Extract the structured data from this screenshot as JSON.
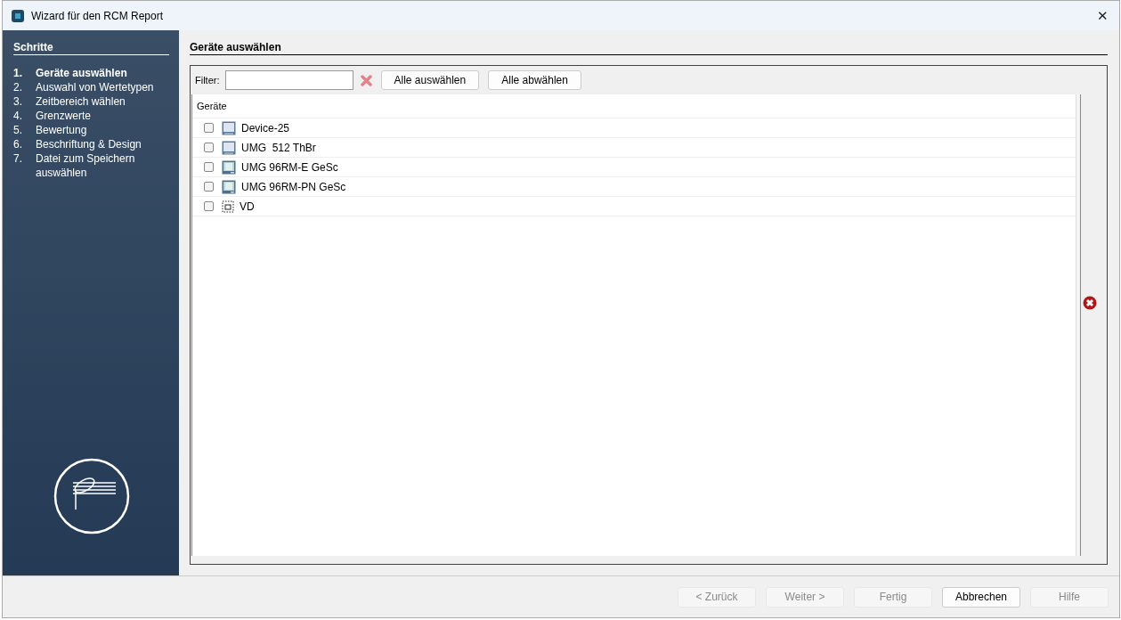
{
  "window": {
    "title": "Wizard für den RCM Report",
    "close": "✕"
  },
  "sidebar": {
    "heading": "Schritte",
    "steps": [
      {
        "number": "1.",
        "label": "Geräte auswählen",
        "selected": true
      },
      {
        "number": "2.",
        "label": "Auswahl von Wertetypen",
        "selected": false
      },
      {
        "number": "3.",
        "label": "Zeitbereich wählen",
        "selected": false
      },
      {
        "number": "4.",
        "label": "Grenzwerte",
        "selected": false
      },
      {
        "number": "5.",
        "label": "Bewertung",
        "selected": false
      },
      {
        "number": "6.",
        "label": "Beschriftung & Design",
        "selected": false
      },
      {
        "number": "7.",
        "label": "Datei zum Speichern auswählen",
        "selected": false
      }
    ]
  },
  "page": {
    "title": "Geräte auswählen",
    "filter_label": "Filter:",
    "select_all": "Alle auswählen",
    "deselect_all": "Alle abwählen",
    "table": {
      "column": "Geräte",
      "rows": [
        {
          "name": "Device-25",
          "kind": "monitor",
          "checked": false
        },
        {
          "name": "UMG  512 ThBr",
          "kind": "monitor",
          "checked": false
        },
        {
          "name": "UMG 96RM-E GeSc",
          "kind": "meter",
          "checked": false
        },
        {
          "name": "UMG 96RM-PN GeSc",
          "kind": "meter",
          "checked": false
        },
        {
          "name": "VD",
          "kind": "virtual",
          "checked": false
        }
      ]
    }
  },
  "buttons": [
    {
      "label": "< Zurück",
      "disabled": true
    },
    {
      "label": "Weiter >",
      "disabled": true
    },
    {
      "label": "Fertig",
      "disabled": true
    },
    {
      "label": "Abbrechen",
      "disabled": false
    },
    {
      "label": "Hilfe",
      "disabled": true
    }
  ]
}
